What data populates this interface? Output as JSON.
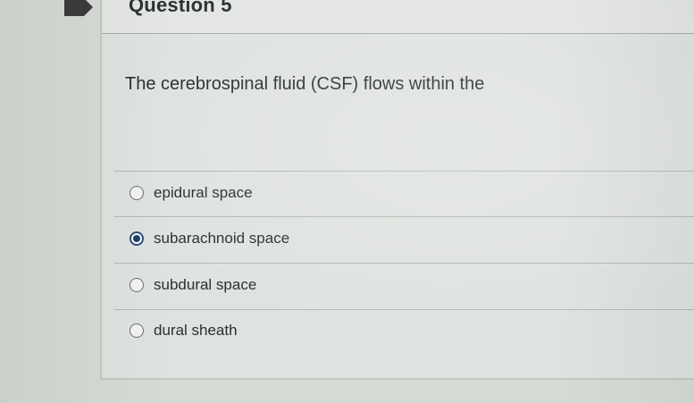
{
  "question": {
    "title": "Question 5",
    "text": "The cerebrospinal fluid (CSF) flows within the"
  },
  "answers": [
    {
      "label": "epidural space",
      "selected": false
    },
    {
      "label": "subarachnoid space",
      "selected": true
    },
    {
      "label": "subdural space",
      "selected": false
    },
    {
      "label": "dural sheath",
      "selected": false
    }
  ],
  "colors": {
    "flag": "#3c3c3c",
    "radio_selected": "#25406b",
    "background": "#d6dbd6"
  },
  "icons": {
    "flag": "flag-icon"
  }
}
